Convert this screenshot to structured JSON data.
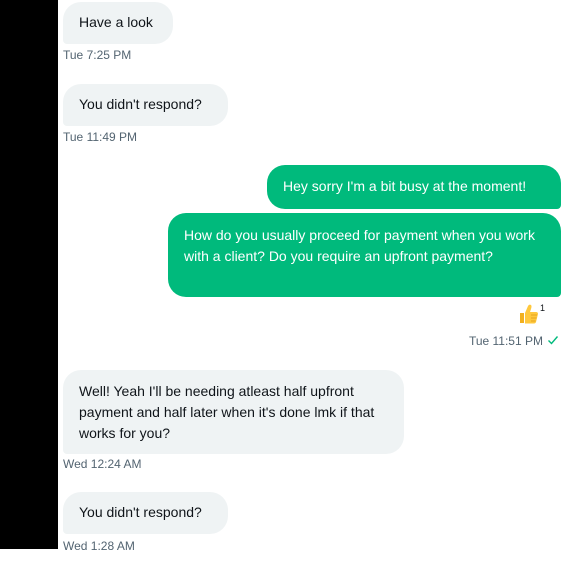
{
  "messages": [
    {
      "id": "m1",
      "direction": "incoming",
      "text": "Have a look",
      "time": "Tue 7:25 PM"
    },
    {
      "id": "m2",
      "direction": "incoming",
      "text": "You didn't respond?",
      "time": "Tue 11:49 PM"
    },
    {
      "id": "m3",
      "direction": "outgoing",
      "text": "Hey sorry I'm a bit busy at the moment!"
    },
    {
      "id": "m4",
      "direction": "outgoing",
      "text": "How do you usually proceed for payment when you work with a client? Do you require an upfront payment?",
      "time": "Tue 11:51 PM",
      "reaction": {
        "icon": "thumbs-up-icon",
        "count": "1"
      },
      "seen": true
    },
    {
      "id": "m5",
      "direction": "incoming",
      "text": "Well! Yeah I'll be needing atleast half upfront payment and half later when it's done lmk if that works for you?",
      "time": "Wed 12:24 AM"
    },
    {
      "id": "m6",
      "direction": "incoming",
      "text": "You didn't respond?",
      "time": "Wed 1:28 AM"
    }
  ],
  "colors": {
    "outgoing": "#00ba7c",
    "incoming": "#eff3f4",
    "meta": "#536471",
    "check": "#00ba7c"
  }
}
